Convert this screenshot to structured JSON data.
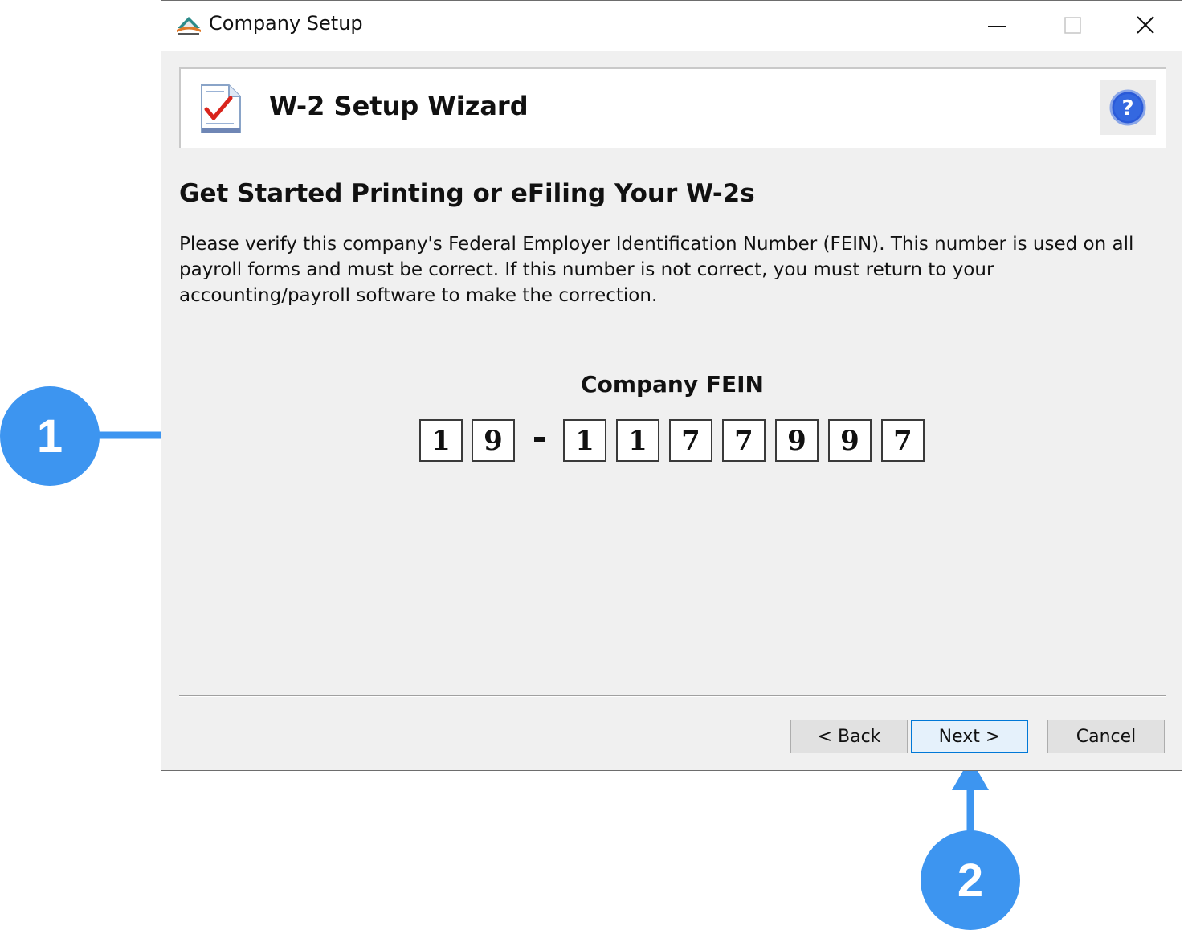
{
  "window": {
    "title": "Company Setup",
    "controls": {
      "minimize": "minimize-icon",
      "maximize": "maximize-icon",
      "close": "close-icon"
    }
  },
  "header": {
    "title": "W-2 Setup Wizard",
    "icon": "document-checkmark-icon",
    "help_icon": "help-icon"
  },
  "content": {
    "heading": "Get Started Printing or eFiling Your W-2s",
    "paragraph": "Please verify this company's Federal Employer Identification Number (FEIN). This number is used on all payroll forms and must be correct. If this number is not correct, you must return to your accounting/payroll software to make the correction.",
    "fein_label": "Company FEIN",
    "fein_digits": [
      "1",
      "9",
      "1",
      "1",
      "7",
      "7",
      "9",
      "9",
      "7"
    ],
    "fein_separator": "-"
  },
  "footer": {
    "back_label": "< Back",
    "next_label": "Next >",
    "cancel_label": "Cancel"
  },
  "callouts": {
    "one": "1",
    "two": "2"
  },
  "colors": {
    "callout": "#3d95f0",
    "focus_border": "#0078d7",
    "dialog_bg": "#f0f0f0"
  }
}
